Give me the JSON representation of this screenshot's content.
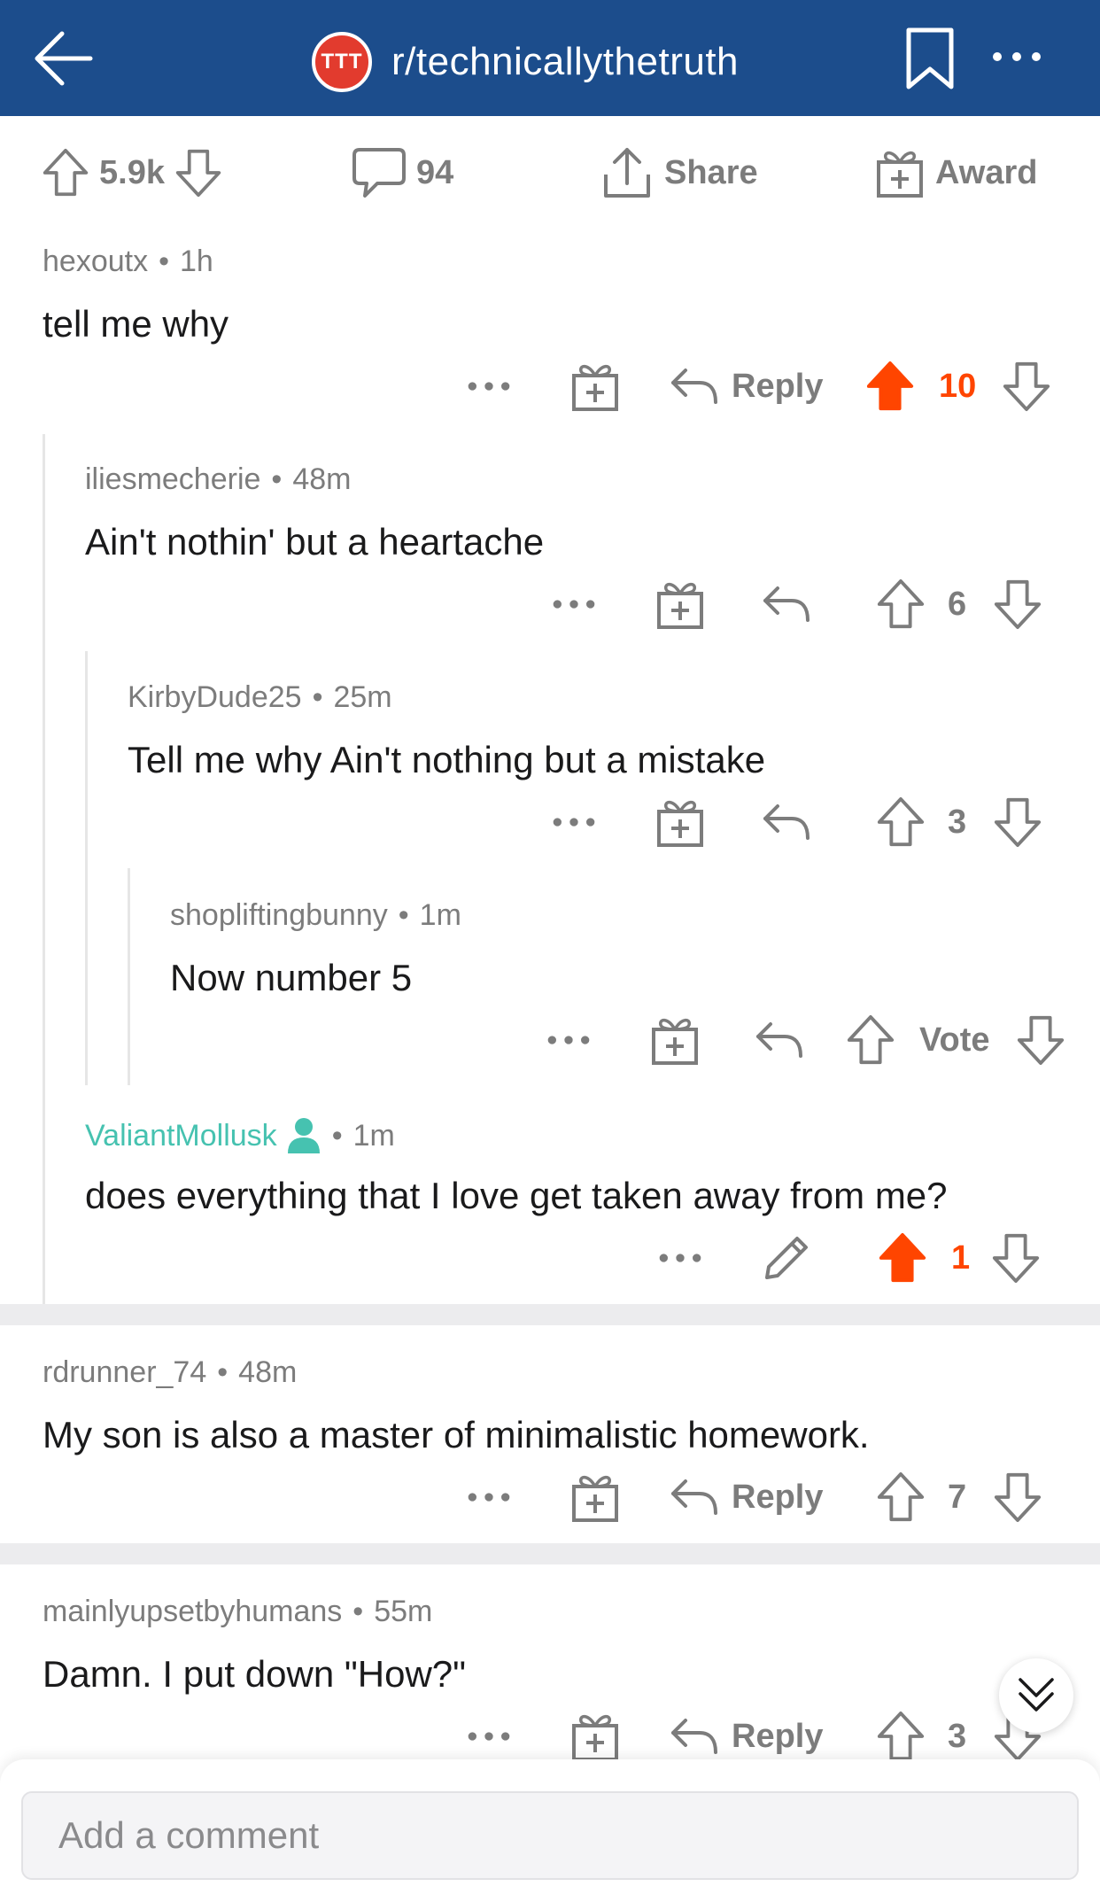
{
  "header": {
    "subreddit_badge": "TTT",
    "subreddit_name": "r/technicallythetruth"
  },
  "post_actions": {
    "score": "5.9k",
    "comment_count": "94",
    "share_label": "Share",
    "award_label": "Award"
  },
  "comments": [
    {
      "author": "hexoutx",
      "age": "1h",
      "text": "tell me why",
      "reply_label": "Reply",
      "score": "10"
    },
    {
      "author": "iliesmecherie",
      "age": "48m",
      "text": "Ain't nothin' but a heartache",
      "score": "6"
    },
    {
      "author": "KirbyDude25",
      "age": "25m",
      "text": "Tell me why Ain't nothing but a mistake",
      "score": "3"
    },
    {
      "author": "shopliftingbunny",
      "age": "1m",
      "text": "Now number 5",
      "score": "Vote"
    },
    {
      "author": "ValiantMollusk",
      "age": "1m",
      "text": "does everything that I love get taken away from me?",
      "score": "1"
    },
    {
      "author": "rdrunner_74",
      "age": "48m",
      "text": "My son is also a master of minimalistic homework.",
      "reply_label": "Reply",
      "score": "7"
    },
    {
      "author": "mainlyupsetbyhumans",
      "age": "55m",
      "text": "Damn. I put down \"How?\"",
      "reply_label": "Reply",
      "score": "3"
    }
  ],
  "composer": {
    "placeholder": "Add a comment"
  },
  "colors": {
    "header_bg": "#1c4d8c",
    "upvote_active": "#ff4500",
    "op_name": "#46c2b0",
    "muted": "#7c7c7c"
  }
}
